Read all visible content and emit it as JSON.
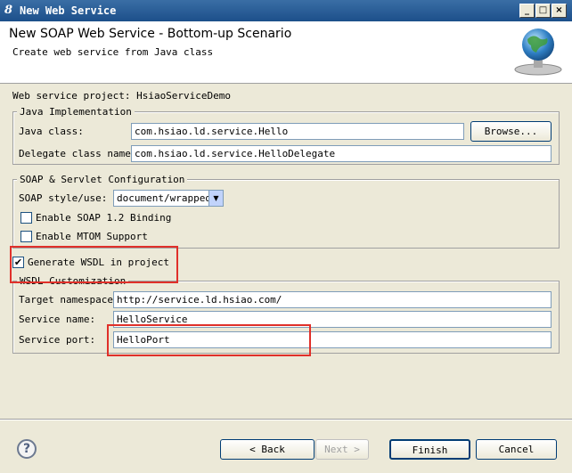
{
  "window": {
    "title": "New Web Service",
    "minimize": "_",
    "maximize": "□",
    "close": "×"
  },
  "header": {
    "title": "New SOAP Web Service - Bottom-up Scenario",
    "subtitle": "Create web service from Java class"
  },
  "project_label": "Web service project: HsiaoServiceDemo",
  "java_impl": {
    "legend": "Java Implementation",
    "java_class_label": "Java class:",
    "java_class_value": "com.hsiao.ld.service.Hello",
    "browse_label": "Browse...",
    "delegate_label": "Delegate class name:",
    "delegate_value": "com.hsiao.ld.service.HelloDelegate"
  },
  "soap": {
    "legend": "SOAP & Servlet Configuration",
    "style_label": "SOAP style/use:",
    "style_value": "document/wrapped",
    "soap12_label": "Enable SOAP 1.2 Binding",
    "soap12_checked": "",
    "mtom_label": "Enable MTOM Support",
    "mtom_checked": ""
  },
  "wsdl": {
    "generate_label": "Generate WSDL in project",
    "generate_checked": "✔",
    "legend": "WSDL Customization",
    "namespace_label": "Target namespace:",
    "namespace_value": "http://service.ld.hsiao.com/",
    "service_name_label": "Service name:",
    "service_name_value": "HelloService",
    "service_port_label": "Service port:",
    "service_port_value": "HelloPort"
  },
  "footer": {
    "help": "?",
    "back": "< Back",
    "next": "Next >",
    "finish": "Finish",
    "cancel": "Cancel"
  },
  "colors": {
    "highlight_box": "#e0302a",
    "titlebar": "#1c4f8a"
  }
}
